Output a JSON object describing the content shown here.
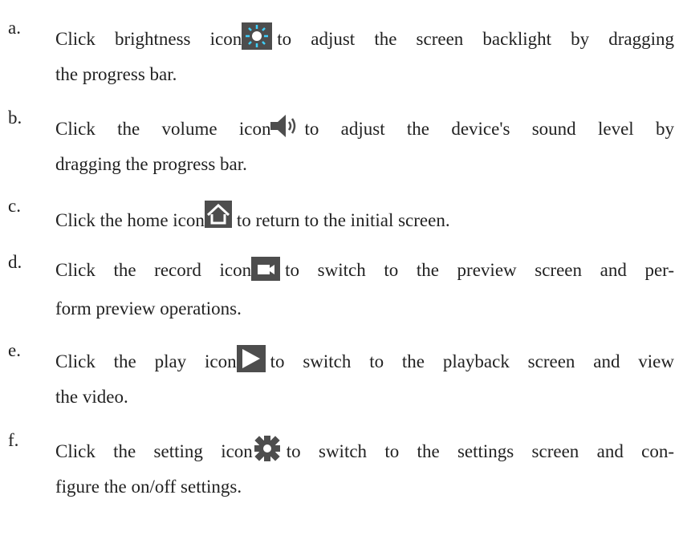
{
  "items": [
    {
      "marker": "a.",
      "before": "Click brightness icon",
      "icon": "brightness-icon",
      "after1": "to adjust the screen backlight by dragging",
      "after2": "the progress bar."
    },
    {
      "marker": "b.",
      "before": "Click the volume icon",
      "icon": "volume-icon",
      "after1": "to adjust the device's sound level by",
      "after2": "dragging the progress bar."
    },
    {
      "marker": "c.",
      "before": "Click the home icon",
      "icon": "home-icon",
      "after1": "to return to the initial screen."
    },
    {
      "marker": "d.",
      "before": "Click the record icon",
      "icon": "record-icon",
      "after1": "to switch to the preview screen and per-",
      "after2": "form preview operations."
    },
    {
      "marker": "e.",
      "before": "Click the play icon",
      "icon": "play-icon",
      "after1": "to switch to the playback screen and view",
      "after2": "the video."
    },
    {
      "marker": "f.",
      "before": "Click the setting icon",
      "icon": "gear-icon",
      "after1": "to switch to the settings screen and con-",
      "after2": "figure the on/off settings."
    }
  ],
  "colors": {
    "icon_bg": "#4d4d4d",
    "icon_fg": "#ffffff",
    "icon_accent": "#3fd1ff",
    "text": "#222222"
  }
}
